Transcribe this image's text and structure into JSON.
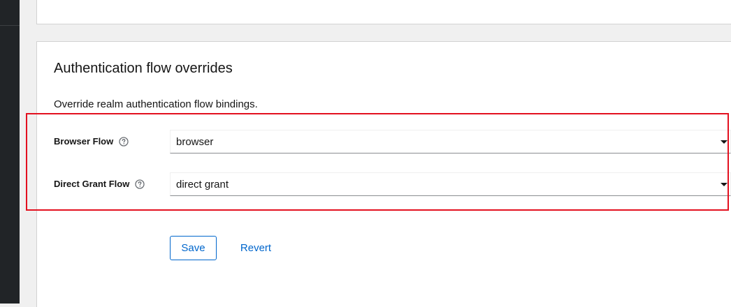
{
  "section": {
    "title": "Authentication flow overrides",
    "description": "Override realm authentication flow bindings."
  },
  "fields": {
    "browser_flow": {
      "label": "Browser Flow",
      "value": "browser"
    },
    "direct_grant_flow": {
      "label": "Direct Grant Flow",
      "value": "direct grant"
    }
  },
  "actions": {
    "save_label": "Save",
    "revert_label": "Revert"
  },
  "colors": {
    "accent": "#0066cc",
    "highlight_border": "#e3101f",
    "sidebar": "#212427"
  },
  "icons": {
    "help": "question-circle-icon",
    "caret": "caret-down-icon"
  }
}
